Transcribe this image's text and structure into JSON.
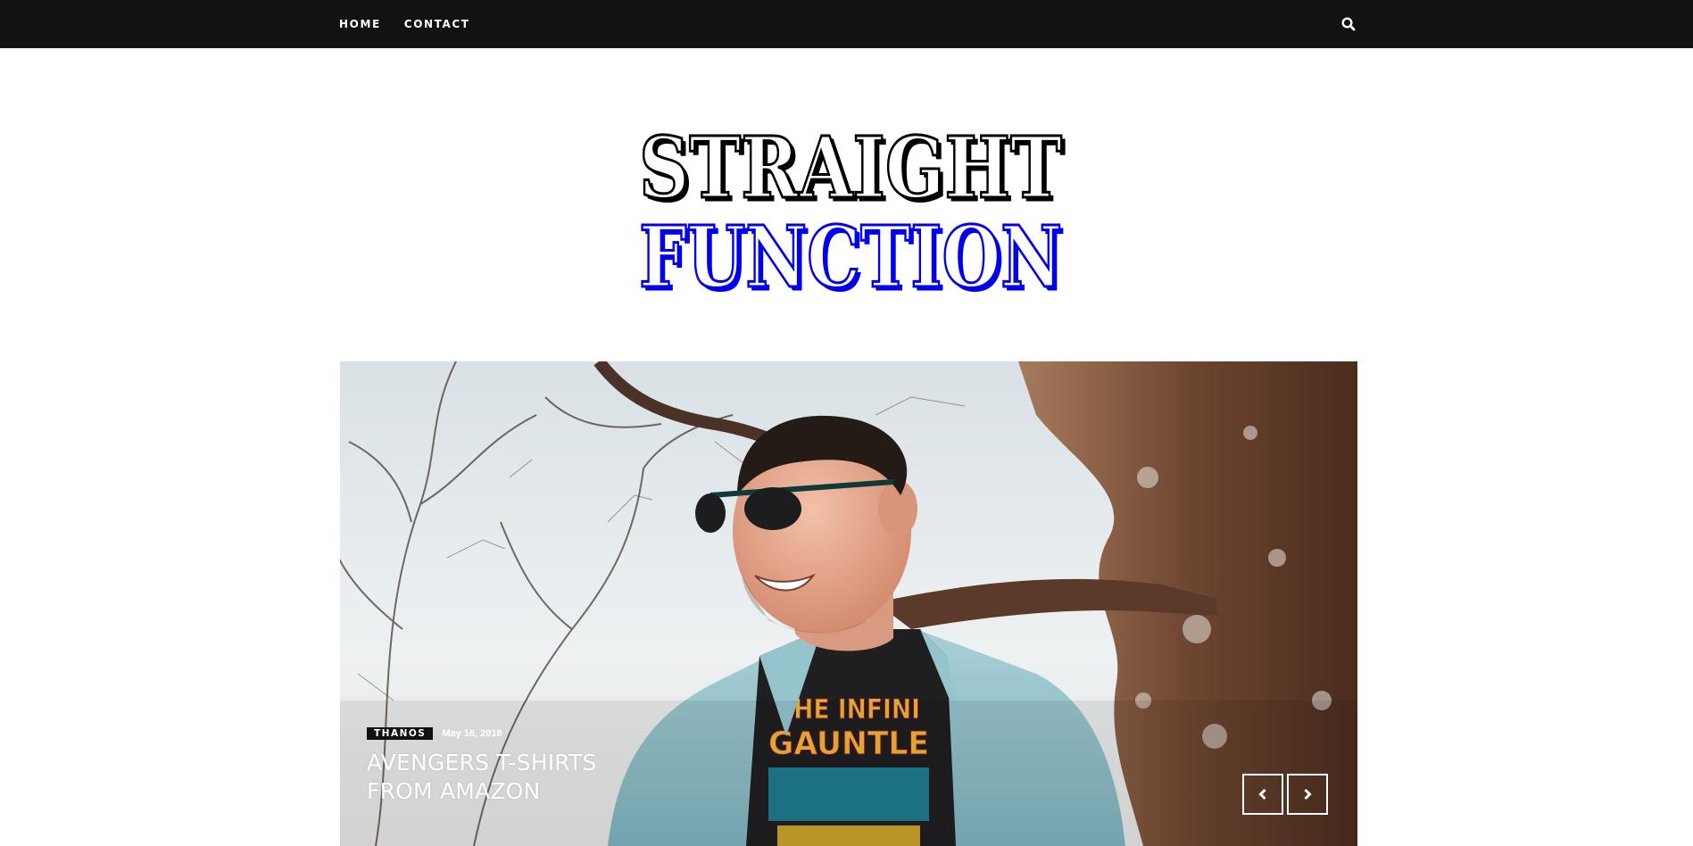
{
  "nav": {
    "items": [
      {
        "label": "HOME"
      },
      {
        "label": "CONTACT"
      }
    ],
    "search_icon": "search-icon",
    "background": "#121212"
  },
  "logo": {
    "line1": "STRAIGHT",
    "line2": "FUNCTION",
    "line1_color": "#000000",
    "line2_color": "#0000ee"
  },
  "slider": {
    "slide": {
      "category": "THANOS",
      "date": "May 16, 2018",
      "title": "AVENGERS T-SHIRTS FROM AMAZON",
      "shirt_print": [
        "THE INFINI",
        "GAUNTLE"
      ]
    },
    "prev_icon": "chevron-left-icon",
    "next_icon": "chevron-right-icon"
  }
}
